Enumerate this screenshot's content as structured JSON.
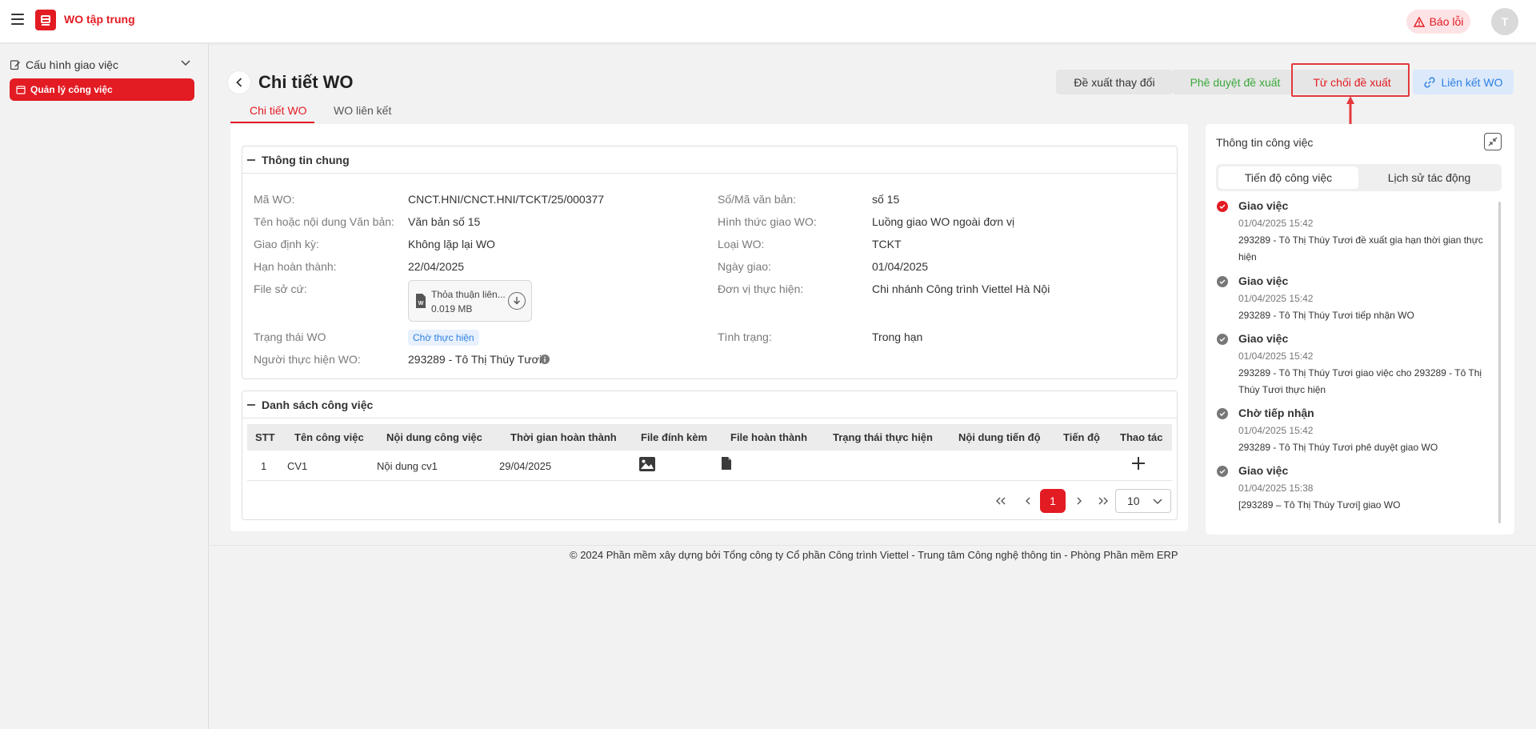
{
  "header": {
    "app_title": "WO tập trung",
    "report_label": "Báo lỗi",
    "avatar_initial": "T",
    "brand_color": "#e31b23"
  },
  "sidebar": {
    "group_label": "Cấu hình giao việc",
    "active_item_label": "Quản lý công việc"
  },
  "page": {
    "title": "Chi tiết WO",
    "actions": {
      "propose_change": "Đề xuất thay đổi",
      "approve_proposal": "Phê duyệt đề xuất",
      "reject_proposal": "Từ chối đề xuất",
      "link_wo": "Liên kết WO"
    },
    "tabs": [
      "Chi tiết WO",
      "WO liên kết"
    ]
  },
  "general_info": {
    "section_title": "Thông tin chung",
    "left": [
      {
        "label": "Mã WO:",
        "value": "CNCT.HNI/CNCT.HNI/TCKT/25/000377"
      },
      {
        "label": "Tên hoặc nội dung Văn bản:",
        "value": "Văn bản số 15"
      },
      {
        "label": "Giao định kỳ:",
        "value": "Không lặp lại WO"
      },
      {
        "label": "Hạn hoàn thành:",
        "value": "22/04/2025"
      },
      {
        "label": "File sở cứ:",
        "value": ""
      },
      {
        "label": "Trạng thái WO",
        "value": ""
      },
      {
        "label": "Người thực hiện WO:",
        "value": "293289 - Tô Thị Thúy Tươi"
      }
    ],
    "right": [
      {
        "label": "Số/Mã văn bản:",
        "value": "số 15"
      },
      {
        "label": "Hình thức giao WO:",
        "value": "Luồng giao WO ngoài đơn vị"
      },
      {
        "label": "Loại WO:",
        "value": "TCKT"
      },
      {
        "label": "Ngày giao:",
        "value": "01/04/2025"
      },
      {
        "label": "Đơn vị thực hiện:",
        "value": "Chi nhánh Công trình Viettel Hà Nội"
      },
      {
        "label": "Tình trạng:",
        "value": "Trong hạn"
      }
    ],
    "file": {
      "name": "Thỏa thuận liên...",
      "size": "0.019 MB"
    },
    "status_tag": "Chờ thực hiện"
  },
  "task_list": {
    "section_title": "Danh sách công việc",
    "columns": [
      "STT",
      "Tên công việc",
      "Nội dung công việc",
      "Thời gian hoàn thành",
      "File đính kèm",
      "File hoàn thành",
      "Trạng thái thực hiện",
      "Nội dung tiến độ",
      "Tiến độ",
      "Thao tác"
    ],
    "rows": [
      {
        "stt": "1",
        "name": "CV1",
        "content": "Nội dung cv1",
        "deadline": "29/04/2025"
      }
    ],
    "pagination": {
      "current_page": "1",
      "page_size": "10"
    }
  },
  "right_panel": {
    "title": "Thông tin công việc",
    "tabs": [
      "Tiến độ công việc",
      "Lịch sử tác động"
    ],
    "timeline": [
      {
        "title": "Giao việc",
        "time": "01/04/2025 15:42",
        "desc": "293289 - Tô Thị Thúy Tươi đề xuất gia hạn thời gian thực hiện",
        "status": "red"
      },
      {
        "title": "Giao việc",
        "time": "01/04/2025 15:42",
        "desc": "293289 - Tô Thị Thúy Tươi tiếp nhận WO",
        "status": "gray"
      },
      {
        "title": "Giao việc",
        "time": "01/04/2025 15:42",
        "desc": "293289 - Tô Thị Thúy Tươi giao việc cho 293289 - Tô Thị Thúy Tươi thực hiện",
        "status": "gray"
      },
      {
        "title": "Chờ tiếp nhận",
        "time": "01/04/2025 15:42",
        "desc": "293289 - Tô Thị Thúy Tươi phê duyệt giao WO",
        "status": "gray"
      },
      {
        "title": "Giao việc",
        "time": "01/04/2025 15:38",
        "desc": "[293289 – Tô Thị Thúy Tươi] giao WO",
        "status": "gray"
      }
    ]
  },
  "footer": {
    "text": "© 2024 Phần mềm xây dựng bởi Tổng công ty Cổ phần Công trình Viettel - Trung tâm Công nghệ thông tin - Phòng Phần mềm ERP"
  }
}
